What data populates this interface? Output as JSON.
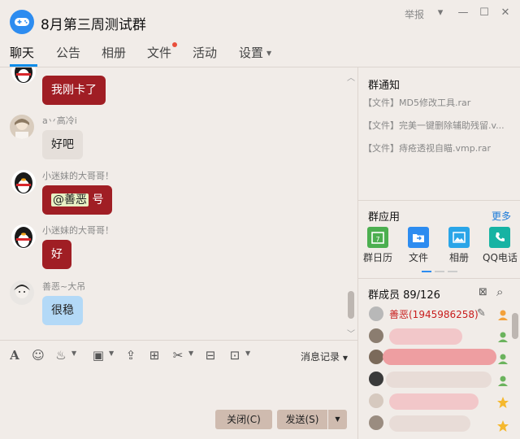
{
  "window": {
    "title": "8月第三周测试群",
    "report_label": "举报",
    "minimize": "—",
    "maximize": "☐",
    "close": "✕",
    "dropdown": "▾"
  },
  "tabs": [
    {
      "label": "聊天"
    },
    {
      "label": "公告"
    },
    {
      "label": "相册"
    },
    {
      "label": "文件"
    },
    {
      "label": "活动"
    },
    {
      "label": "设置"
    }
  ],
  "chat": {
    "messages": [
      {
        "nick": "",
        "text": "我刚卡了",
        "style": "red"
      },
      {
        "nick": "a丷高冷i",
        "text": "好吧",
        "style": "gray"
      },
      {
        "nick": "小迷妹的大哥哥！",
        "mention": "@善恶",
        "text": "号",
        "style": "red"
      },
      {
        "nick": "小迷妹的大哥哥！",
        "text": "好",
        "style": "red"
      },
      {
        "nick": "善恶~大吊",
        "text": "很稳",
        "style": "blue"
      }
    ]
  },
  "toolbar": {
    "icons": [
      "font-icon",
      "emoji-icon",
      "gift-icon",
      "image-icon",
      "upload-icon",
      "giftbox-icon",
      "scissors-icon",
      "red-packet-icon",
      "screenshot-icon"
    ],
    "history_label": "消息记录"
  },
  "actions": {
    "close_label": "关闭(C)",
    "send_label": "发送(S)"
  },
  "notice": {
    "title": "群通知",
    "items": [
      "【文件】MD5修改工具.rar",
      "【文件】完美一键删除辅助残留.v...",
      "【文件】痔疮透视自瞄.vmp.rar"
    ]
  },
  "apps": {
    "title": "群应用",
    "more_label": "更多",
    "items": [
      {
        "label": "群日历",
        "icon": "calendar-icon",
        "color": "#4caf50"
      },
      {
        "label": "文件",
        "icon": "folder-icon",
        "color": "#2d8cf0"
      },
      {
        "label": "相册",
        "icon": "album-icon",
        "color": "#2aa5e8"
      },
      {
        "label": "QQ电话",
        "icon": "phone-icon",
        "color": "#17b3a3"
      }
    ]
  },
  "members": {
    "title": "群成员 89/126",
    "first_member": "善恶(1945986258)"
  }
}
